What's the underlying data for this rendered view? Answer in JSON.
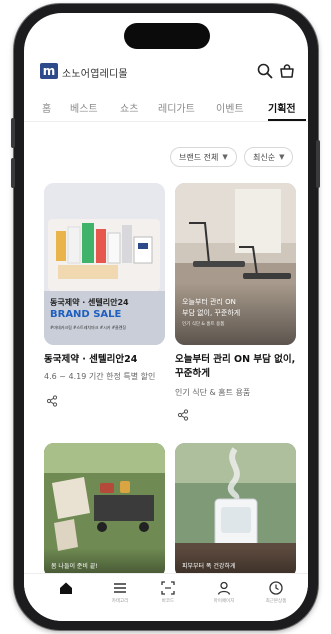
{
  "header": {
    "logo_letter": "m",
    "brand_name": "소노어엽레디몰"
  },
  "tabs": [
    {
      "label": "홈"
    },
    {
      "label": "베스트"
    },
    {
      "label": "쇼츠"
    },
    {
      "label": "레디가트"
    },
    {
      "label": "이벤트"
    },
    {
      "label": "기획전"
    }
  ],
  "filters": {
    "brand": "브랜드 전체",
    "sort": "최신순"
  },
  "cards": [
    {
      "banner_title": "동국제약 · 센텔리안24",
      "banner_sale": "BRAND SALE",
      "banner_small": "#마데카크림 #스트레치마크 #시카 #클렌징",
      "title": "동국제약 · 센텔리안24",
      "subtitle": "4.6 ~ 4.19 기간 한정 특별 할인"
    },
    {
      "banner_title": "오늘부터 관리 ON",
      "banner_sub": "부담 없이, 꾸준하게",
      "banner_small": "인기 식단 & 홈트 용품",
      "title": "오늘부터 관리 ON 부담 없이, 꾸준하게",
      "subtitle": "인기 식단 & 홈트 용품"
    },
    {
      "banner_title": "봄 나들이 준비 끝!"
    },
    {
      "banner_title": "피부부터 폭 건강하게"
    }
  ],
  "bottom_nav": [
    {
      "icon": "home-icon",
      "label": ""
    },
    {
      "icon": "menu-icon",
      "label": "카테고리"
    },
    {
      "icon": "scan-icon",
      "label": "바코드"
    },
    {
      "icon": "user-icon",
      "label": "마이페이지"
    },
    {
      "icon": "clock-icon",
      "label": "최근본상품"
    }
  ],
  "colors": {
    "brand_navy": "#2d4a8a",
    "sale_blue": "#1f5fbf"
  }
}
